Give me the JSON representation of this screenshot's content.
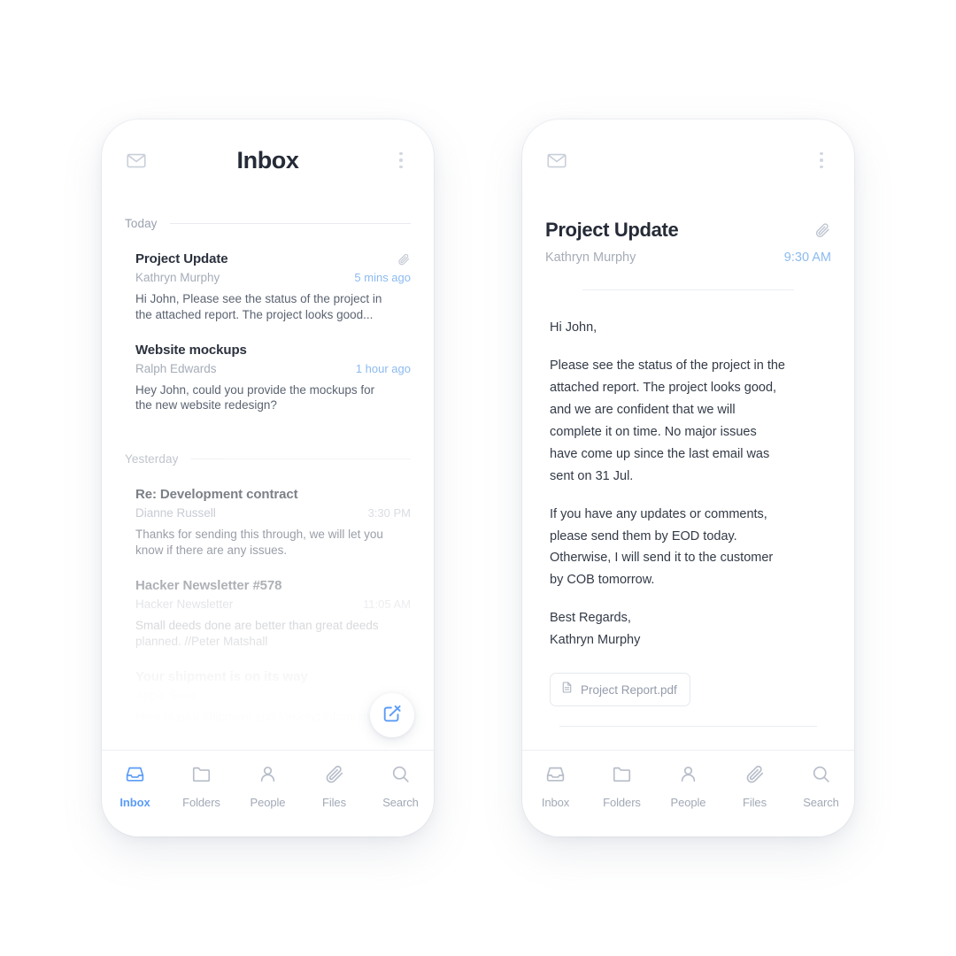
{
  "theme": {
    "accent_blue": "#5b9cf8",
    "light_blue": "#8cbaf0",
    "text_dark": "#252b37",
    "text_muted": "#a6acb8",
    "divider": "#eaedf2",
    "background": "#ffffff"
  },
  "inbox_screen": {
    "appbar": {
      "mail_icon": "mail-icon",
      "title": "Inbox",
      "overflow_icon": "kebab-menu-icon"
    },
    "sections": [
      {
        "label": "Today",
        "items": [
          {
            "subject": "Project Update",
            "sender": "Kathryn Murphy",
            "time": "5 mins ago",
            "preview": "Hi John, Please see the status of the project in the attached report. The project looks good...",
            "has_attachment": true,
            "time_accent": true,
            "dim": ""
          },
          {
            "subject": "Website mockups",
            "sender": "Ralph Edwards",
            "time": "1 hour ago",
            "preview": "Hey John, could you provide the mockups for the new website redesign?",
            "has_attachment": false,
            "time_accent": true,
            "dim": ""
          }
        ]
      },
      {
        "label": "Yesterday",
        "items": [
          {
            "subject": "Re: Development contract",
            "sender": "Dianne Russell",
            "time": "3:30 PM",
            "preview": "Thanks for sending this through, we will let you know if there are any issues.",
            "has_attachment": false,
            "time_accent": false,
            "dim": "dim-1"
          },
          {
            "subject": "Hacker Newsletter #578",
            "sender": "Hacker Newsletter",
            "time": "11:05 AM",
            "preview": "Small deeds done are better than great deeds planned. //Peter Matshall",
            "has_attachment": false,
            "time_accent": false,
            "dim": "dim-2"
          },
          {
            "subject": "Your shipment is on its way",
            "sender": "Apple Store",
            "time": "9:45 AM",
            "preview": "Here is your shipment and tracking information",
            "has_attachment": false,
            "time_accent": false,
            "dim": "dim-3"
          }
        ]
      }
    ],
    "compose_fab": "compose-icon",
    "nav": [
      {
        "label": "Inbox",
        "icon": "inbox-icon",
        "active": true
      },
      {
        "label": "Folders",
        "icon": "folder-icon",
        "active": false
      },
      {
        "label": "People",
        "icon": "person-icon",
        "active": false
      },
      {
        "label": "Files",
        "icon": "paperclip-icon",
        "active": false
      },
      {
        "label": "Search",
        "icon": "search-icon",
        "active": false
      }
    ]
  },
  "detail_screen": {
    "appbar": {
      "mail_icon": "mail-icon",
      "overflow_icon": "kebab-menu-icon"
    },
    "header": {
      "title": "Project Update",
      "sender": "Kathryn Murphy",
      "time": "9:30 AM",
      "attachment_icon": "paperclip-icon"
    },
    "body": {
      "greeting": "Hi John,",
      "paragraph_1": "Please see the status of the project in the attached report. The project looks good, and we are confident that we will complete it on time. No major issues have come up since the last email was sent on 31 Jul.",
      "paragraph_2": "If you have any updates or comments, please send them by EOD today. Otherwise, I will send it to the customer by COB tomorrow.",
      "signoff": "Best Regards,\nKathryn Murphy"
    },
    "attachment": {
      "icon": "document-icon",
      "name": "Project Report.pdf"
    },
    "toolbar": [
      {
        "name": "reply-all-button",
        "icon": "reply-all-icon"
      },
      {
        "name": "reply-button",
        "icon": "reply-icon"
      },
      {
        "name": "forward-button",
        "icon": "forward-icon"
      },
      {
        "name": "delete-button",
        "icon": "trash-icon"
      },
      {
        "name": "move-button",
        "icon": "move-to-folder-icon"
      },
      {
        "name": "archive-button",
        "icon": "archive-icon"
      }
    ],
    "nav": [
      {
        "label": "Inbox",
        "icon": "inbox-icon",
        "active": false
      },
      {
        "label": "Folders",
        "icon": "folder-icon",
        "active": false
      },
      {
        "label": "People",
        "icon": "person-icon",
        "active": false
      },
      {
        "label": "Files",
        "icon": "paperclip-icon",
        "active": false
      },
      {
        "label": "Search",
        "icon": "search-icon",
        "active": false
      }
    ]
  }
}
